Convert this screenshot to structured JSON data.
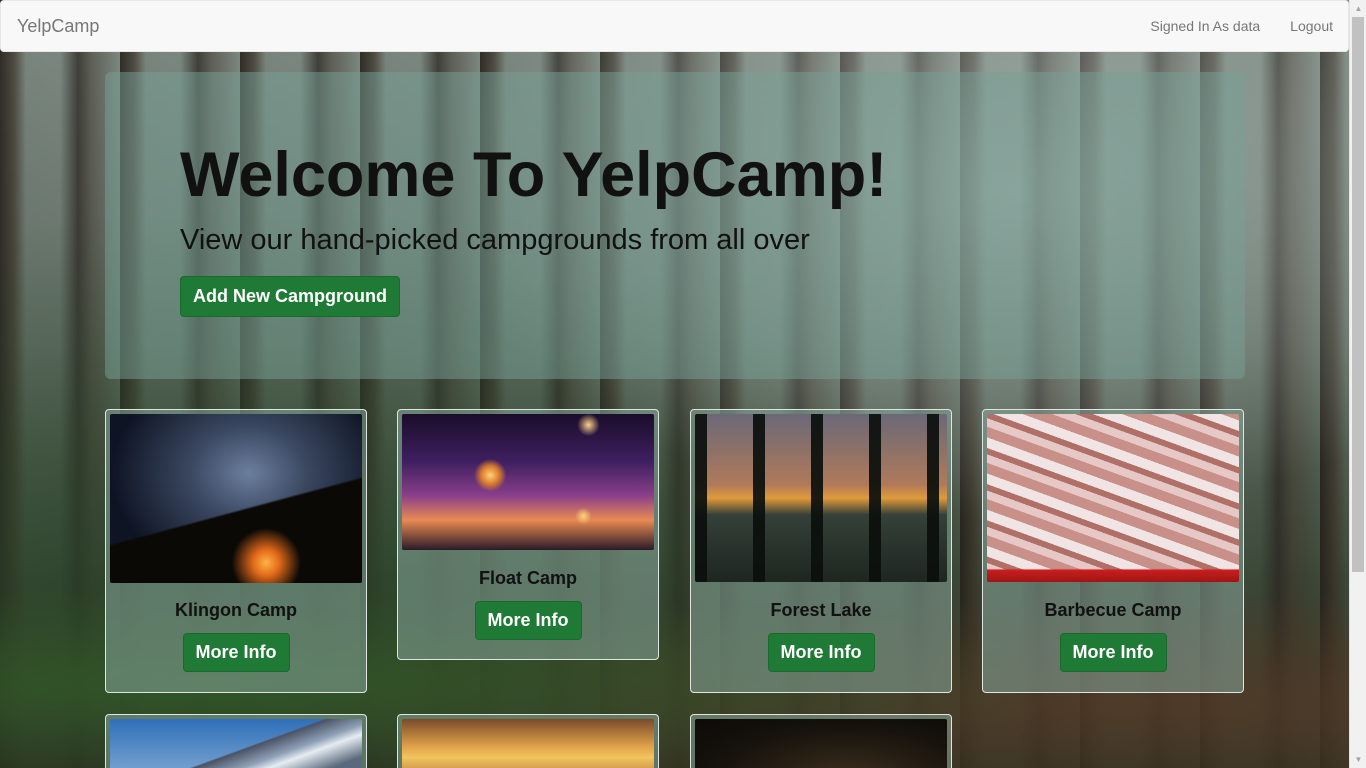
{
  "navbar": {
    "brand": "YelpCamp",
    "signed_in": "Signed In As data",
    "logout": "Logout"
  },
  "jumbotron": {
    "title": "Welcome To YelpCamp!",
    "subtitle": "View our hand-picked campgrounds from all over",
    "add_button": "Add New Campground"
  },
  "campgrounds": [
    {
      "name": "Klingon Camp",
      "button": "More Info",
      "image_icon": "starry-night-campfire-image"
    },
    {
      "name": "Float Camp",
      "button": "More Info",
      "image_icon": "hanging-tent-sunset-image"
    },
    {
      "name": "Forest Lake",
      "button": "More Info",
      "image_icon": "forest-lake-sunset-image"
    },
    {
      "name": "Barbecue Camp",
      "button": "More Info",
      "image_icon": "grilled-sausages-image"
    },
    {
      "name": "",
      "button": "",
      "image_icon": "mountain-image"
    },
    {
      "name": "",
      "button": "",
      "image_icon": "sunset-image"
    },
    {
      "name": "",
      "button": "",
      "image_icon": "dark-night-image"
    }
  ],
  "colors": {
    "button_green": "#1f7a36",
    "navbar_bg": "#f8f8f8",
    "navbar_text": "#777777"
  }
}
